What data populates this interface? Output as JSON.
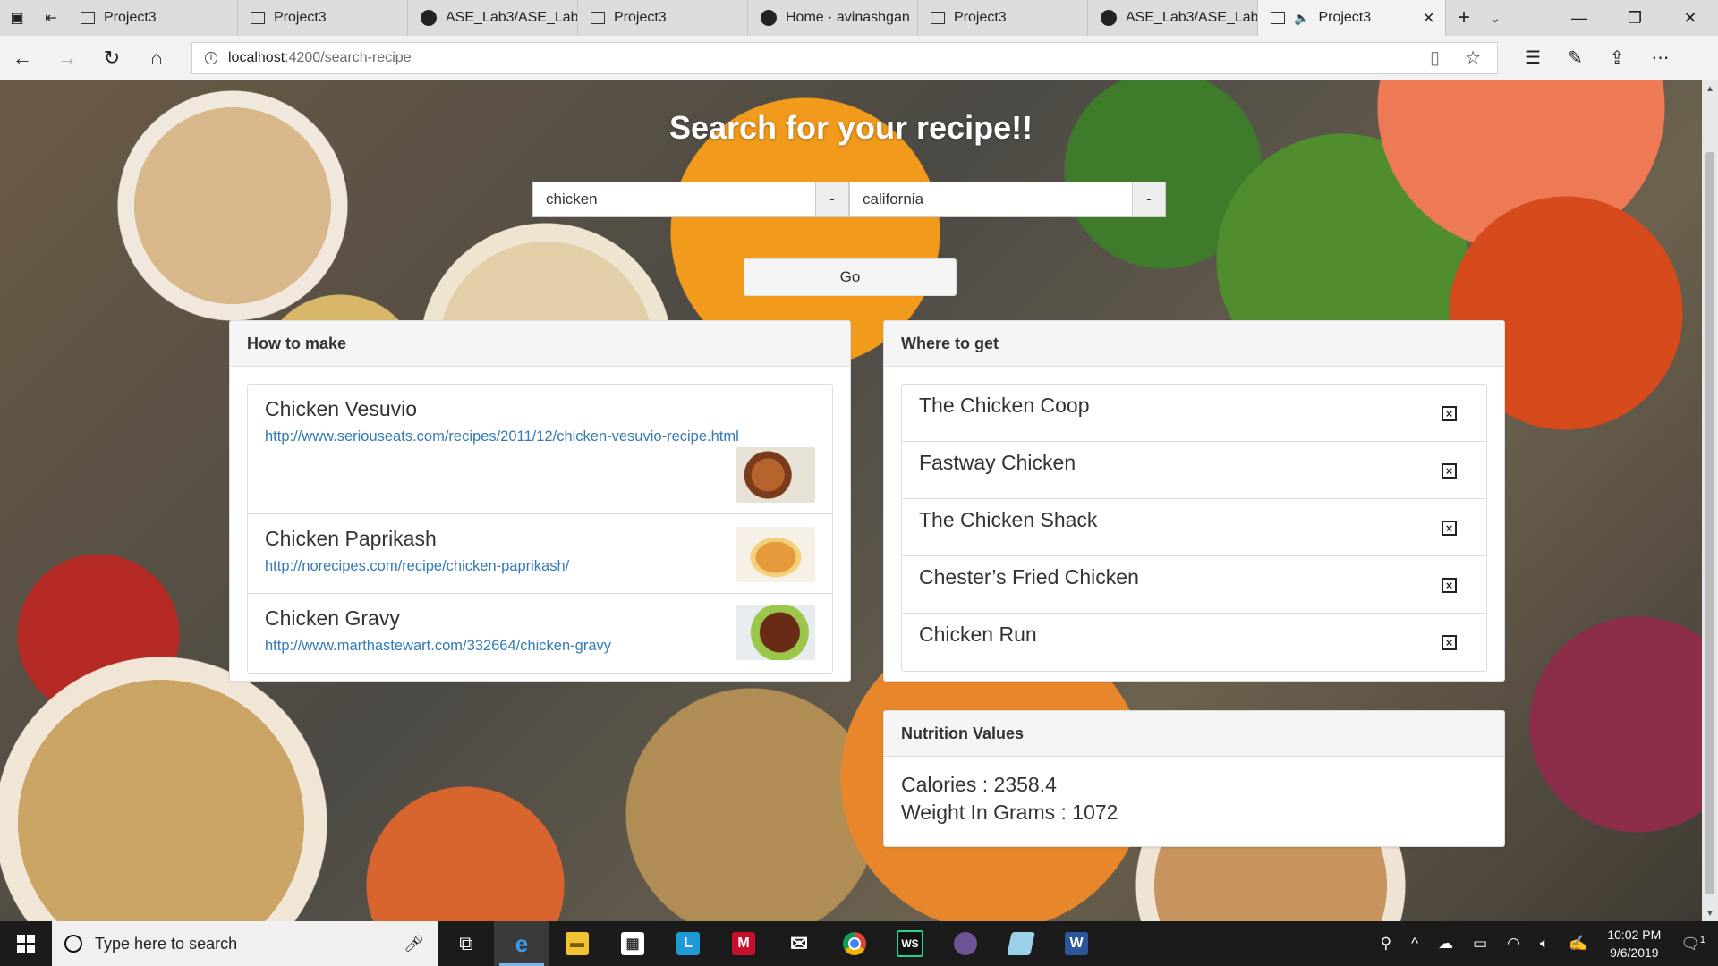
{
  "browser": {
    "tabs": [
      {
        "label": "Project3",
        "icon": "page-icon",
        "active": false
      },
      {
        "label": "Project3",
        "icon": "page-icon",
        "active": false
      },
      {
        "label": "ASE_Lab3/ASE_Lab:",
        "icon": "github-icon",
        "active": false
      },
      {
        "label": "Project3",
        "icon": "page-icon",
        "active": false
      },
      {
        "label": "Home · avinashgan",
        "icon": "github-icon",
        "active": false
      },
      {
        "label": "Project3",
        "icon": "page-icon",
        "active": false
      },
      {
        "label": "ASE_Lab3/ASE_Lab:",
        "icon": "github-icon",
        "active": false
      },
      {
        "label": "Project3",
        "icon": "page-icon",
        "active": true
      }
    ],
    "url_host": "localhost",
    "url_path": ":4200/search-recipe"
  },
  "page": {
    "title": "Search for your recipe!!",
    "search": {
      "recipe_value": "chicken",
      "recipe_addon": "-",
      "location_value": "california",
      "location_addon": "-",
      "go_label": "Go"
    },
    "how_to_make": {
      "heading": "How to make",
      "recipes": [
        {
          "name": "Chicken Vesuvio",
          "url": "http://www.seriouseats.com/recipes/2011/12/chicken-vesuvio-recipe.html"
        },
        {
          "name": "Chicken Paprikash",
          "url": "http://norecipes.com/recipe/chicken-paprikash/"
        },
        {
          "name": "Chicken Gravy",
          "url": "http://www.marthastewart.com/332664/chicken-gravy"
        }
      ]
    },
    "where_to_get": {
      "heading": "Where to get",
      "stores": [
        "The Chicken Coop",
        "Fastway Chicken",
        "The Chicken Shack",
        "Chester’s Fried Chicken",
        "Chicken Run"
      ]
    },
    "nutrition": {
      "heading": "Nutrition Values",
      "calories_label": "Calories : 2358.4",
      "weight_label": "Weight In Grams : 1072"
    }
  },
  "taskbar": {
    "search_placeholder": "Type here to search",
    "time": "10:02 PM",
    "date": "9/6/2019",
    "notification_count": "1"
  },
  "colors": {
    "link": "#337ab7",
    "panel_heading_bg": "#f5f5f5",
    "taskbar_bg": "#1b1b1b"
  }
}
